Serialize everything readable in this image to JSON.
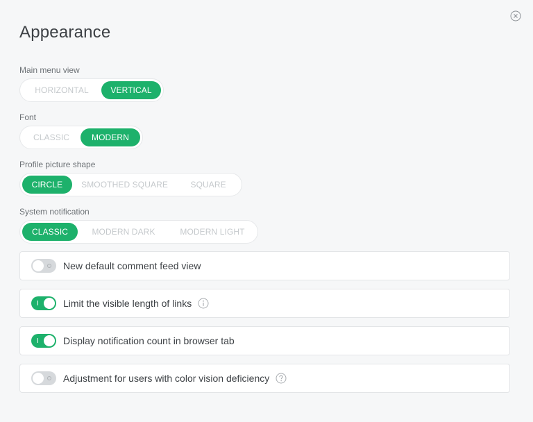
{
  "panel": {
    "title": "Appearance"
  },
  "close": {
    "icon": "close-circle-icon"
  },
  "groups": {
    "menu_view": {
      "label": "Main menu view",
      "options": [
        "HORIZONTAL",
        "VERTICAL"
      ],
      "selected": "VERTICAL"
    },
    "font": {
      "label": "Font",
      "options": [
        "CLASSIC",
        "MODERN"
      ],
      "selected": "MODERN"
    },
    "picture_shape": {
      "label": "Profile picture shape",
      "options": [
        "CIRCLE",
        "SMOOTHED SQUARE",
        "SQUARE"
      ],
      "selected": "CIRCLE"
    },
    "notification": {
      "label": "System notification",
      "options": [
        "CLASSIC",
        "MODERN DARK",
        "MODERN LIGHT"
      ],
      "selected": "CLASSIC"
    }
  },
  "toggles": [
    {
      "label": "New default comment feed view",
      "on": false,
      "icon": ""
    },
    {
      "label": "Limit the visible length of links",
      "on": true,
      "icon": "info-icon"
    },
    {
      "label": "Display notification count in browser tab",
      "on": true,
      "icon": ""
    },
    {
      "label": "Adjustment for users with color vision deficiency",
      "on": false,
      "icon": "help-icon"
    }
  ],
  "colors": {
    "accent": "#1db16b",
    "toggle_off": "#d6d9dc",
    "background": "#f6f7f8"
  }
}
